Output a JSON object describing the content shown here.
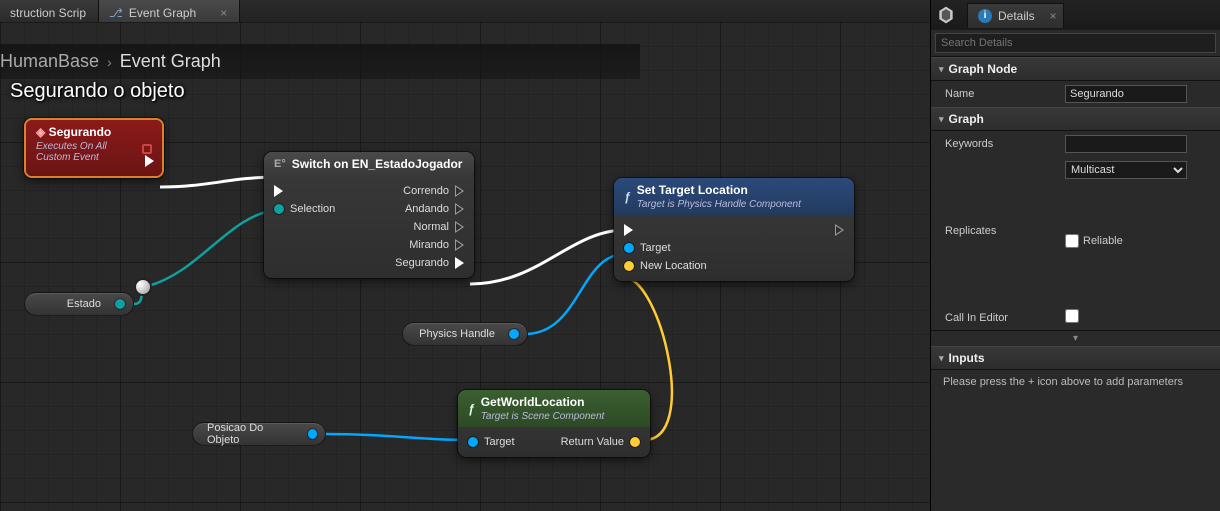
{
  "tabs": [
    {
      "label": "struction Scrip"
    },
    {
      "label": "Event Graph"
    }
  ],
  "breadcrumb": {
    "blueprint": "HumanBase",
    "graph": "Event Graph"
  },
  "section_title": "Segurando o objeto",
  "nodes": {
    "segurando": {
      "title": "Segurando",
      "subtitle": "Executes On All\nCustom Event"
    },
    "switch": {
      "title": "Switch on EN_EstadoJogador",
      "selection_label": "Selection",
      "outputs": [
        "Correndo",
        "Andando",
        "Normal",
        "Mirando",
        "Segurando"
      ]
    },
    "set_target": {
      "title": "Set Target Location",
      "subtitle": "Target is Physics Handle Component",
      "pins": {
        "target": "Target",
        "new_location": "New Location"
      }
    },
    "get_world": {
      "title": "GetWorldLocation",
      "subtitle": "Target is Scene Component",
      "pins": {
        "target": "Target",
        "return_value": "Return Value"
      }
    }
  },
  "vars": {
    "estado": "Estado",
    "physics_handle": "Physics Handle",
    "posicao": "Posicao Do Objeto"
  },
  "details": {
    "tab_label": "Details",
    "search_placeholder": "Search Details",
    "graph_node": {
      "header": "Graph Node",
      "name_label": "Name",
      "name_value": "Segurando"
    },
    "graph": {
      "header": "Graph",
      "keywords_label": "Keywords",
      "keywords_value": "",
      "replicates_label": "Replicates",
      "replicates_value": "Multicast",
      "reliable_label": "Reliable",
      "call_in_editor_label": "Call In Editor"
    },
    "inputs": {
      "header": "Inputs",
      "hint": "Please press the + icon above to add parameters"
    }
  }
}
